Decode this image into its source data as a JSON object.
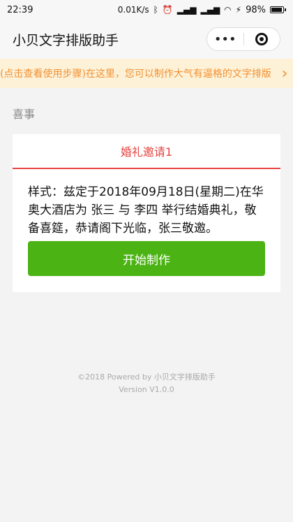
{
  "statusbar": {
    "time": "22:39",
    "network": "0.01K/s",
    "battery": "98%"
  },
  "navbar": {
    "title": "小贝文字排版助手"
  },
  "notice": {
    "text": "(点击查看使用步骤)在这里，您可以制作大气有逼格的文字排版"
  },
  "section": {
    "title": "喜事"
  },
  "card": {
    "tab": "婚礼邀请1",
    "content": "样式：兹定于2018年09月18日(星期二)在华奥大酒店为 张三 与 李四 举行结婚典礼，敬备喜筵，恭请阁下光临，张三敬邀。",
    "button": "开始制作"
  },
  "footer": {
    "powered": "©2018 Powered by 小贝文字排版助手",
    "version": "Version V1.0.0"
  },
  "colors": {
    "accent": "#e64340",
    "primary": "#4bb414",
    "notice": "#f39033"
  }
}
